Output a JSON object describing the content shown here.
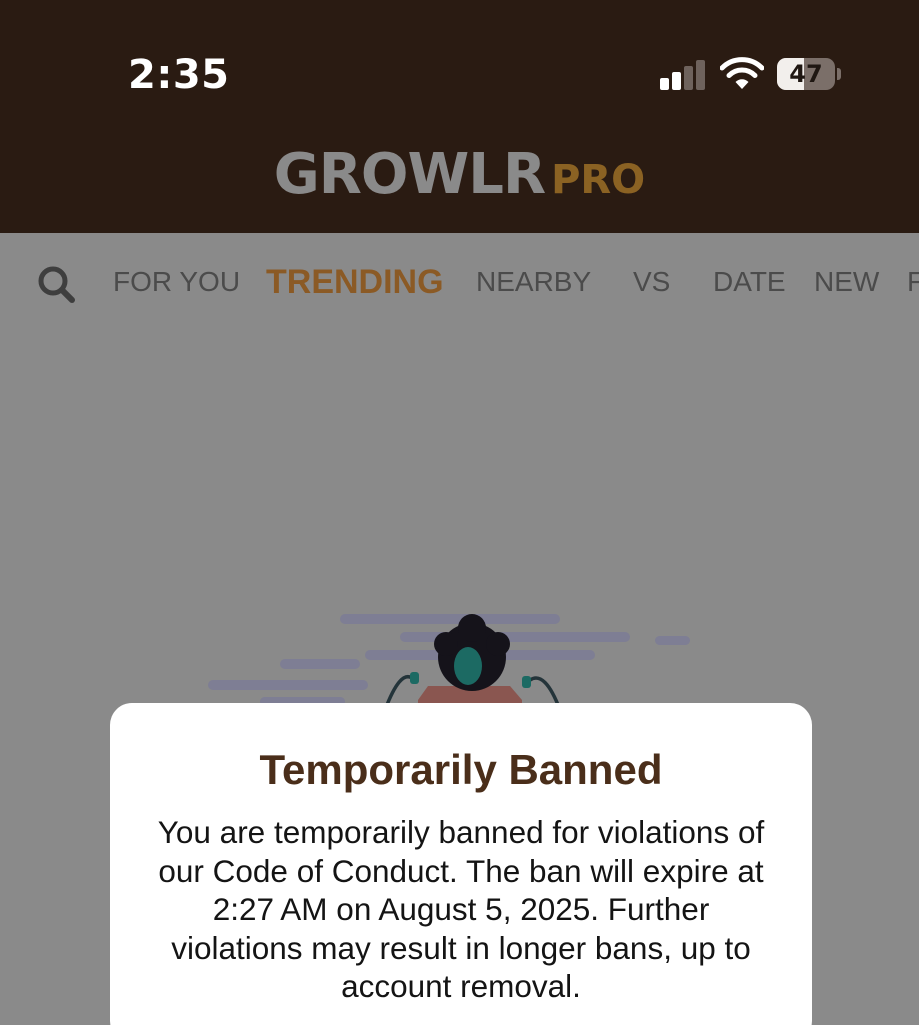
{
  "status_bar": {
    "time": "2:35",
    "battery_level": "47",
    "battery_fraction": 0.47,
    "signal_bars_active": 2,
    "signal_bars_total": 4
  },
  "header": {
    "logo_main": "GROWLR",
    "logo_pro": "PRO"
  },
  "nav": {
    "tabs": [
      {
        "label": "FOR YOU",
        "active": false
      },
      {
        "label": "TRENDING",
        "active": true
      },
      {
        "label": "NEARBY",
        "active": false
      },
      {
        "label": "VS",
        "active": false
      },
      {
        "label": "DATE",
        "active": false
      },
      {
        "label": "NEW",
        "active": false
      },
      {
        "label": "F",
        "active": false
      }
    ]
  },
  "dialog": {
    "title": "Temporarily Banned",
    "body": "You are temporarily banned for violations of our Code of Conduct. The ban will expire at 2:27 AM on August 5, 2025. Further violations may result in longer bans, up to account removal."
  },
  "colors": {
    "header_bg": "#2a1b12",
    "overlay_bg": "#8a8a8a",
    "accent_brown": "#8b5a25",
    "title_brown": "#4a2e1a"
  },
  "icons": {
    "search": "search-icon",
    "signal": "cellular-signal-icon",
    "wifi": "wifi-icon",
    "battery": "battery-icon"
  }
}
